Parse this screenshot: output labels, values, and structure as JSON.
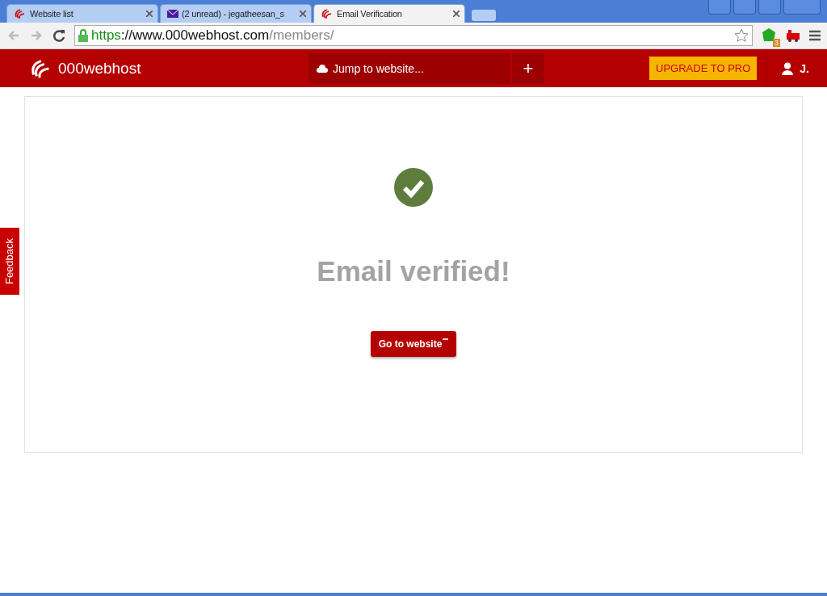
{
  "browser": {
    "tabs": [
      {
        "title": "Website list",
        "kind": "site",
        "selected": false
      },
      {
        "title": "(2 unread) - jegatheesan_s",
        "kind": "mail",
        "selected": false
      },
      {
        "title": "Email Verification",
        "kind": "site",
        "selected": true
      }
    ],
    "url": {
      "scheme": "https",
      "host": "://www.000webhost.com",
      "path": "/members/"
    },
    "extension_badge": "3"
  },
  "header": {
    "brand": "000webhost",
    "jump": "Jump to website...",
    "add": "+",
    "upgrade": "UPGRADE TO PRO",
    "user": "J."
  },
  "feedback": "Feedback",
  "main": {
    "title": "Email verified!",
    "button": "Go to website"
  }
}
